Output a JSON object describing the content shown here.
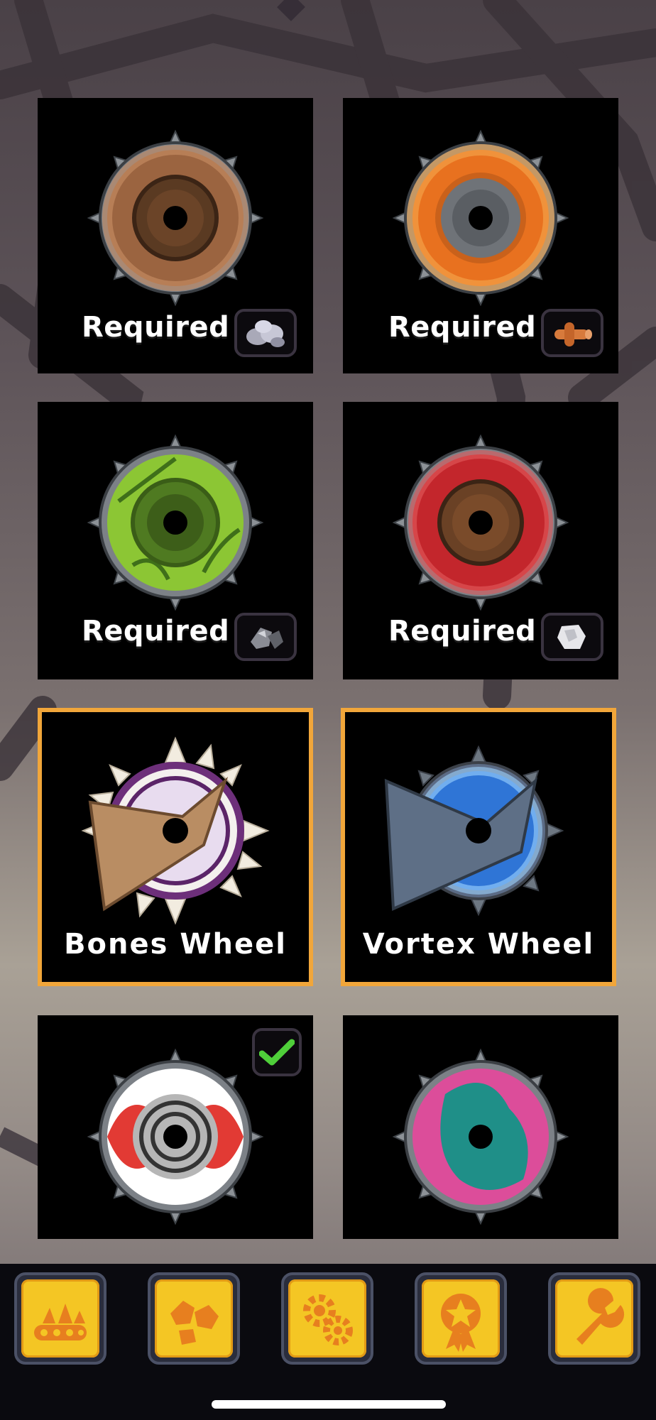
{
  "wheels": [
    {
      "id": "brown",
      "label": "Required",
      "resource": "stone-pile-icon",
      "colors": [
        "#8a5634",
        "#c98f65"
      ]
    },
    {
      "id": "orange",
      "label": "Required",
      "resource": "wood-log-icon",
      "colors": [
        "#e8711f",
        "#f5a84e"
      ]
    },
    {
      "id": "green",
      "label": "Required",
      "resource": "metal-ore-icon",
      "colors": [
        "#7ab52d",
        "#4f7a21"
      ]
    },
    {
      "id": "red",
      "label": "Required",
      "resource": "rock-chunk-icon",
      "colors": [
        "#c3262c",
        "#e35b5e"
      ]
    },
    {
      "id": "bones",
      "label": "Bones Wheel",
      "selected": true
    },
    {
      "id": "vortex",
      "label": "Vortex Wheel",
      "selected": true
    },
    {
      "id": "candy",
      "equipped": true,
      "status_icon": "checkmark-icon"
    },
    {
      "id": "unicorn"
    }
  ],
  "tabs": [
    {
      "name": "tab-vehicle",
      "icon": "tank-icon"
    },
    {
      "name": "tab-materials",
      "icon": "rocks-icon"
    },
    {
      "name": "tab-parts",
      "icon": "gears-icon"
    },
    {
      "name": "tab-rewards",
      "icon": "star-medal-icon"
    },
    {
      "name": "tab-workshop",
      "icon": "wrench-icon"
    }
  ],
  "accent_color": "#f1a63a",
  "tab_color": "#f4c624"
}
